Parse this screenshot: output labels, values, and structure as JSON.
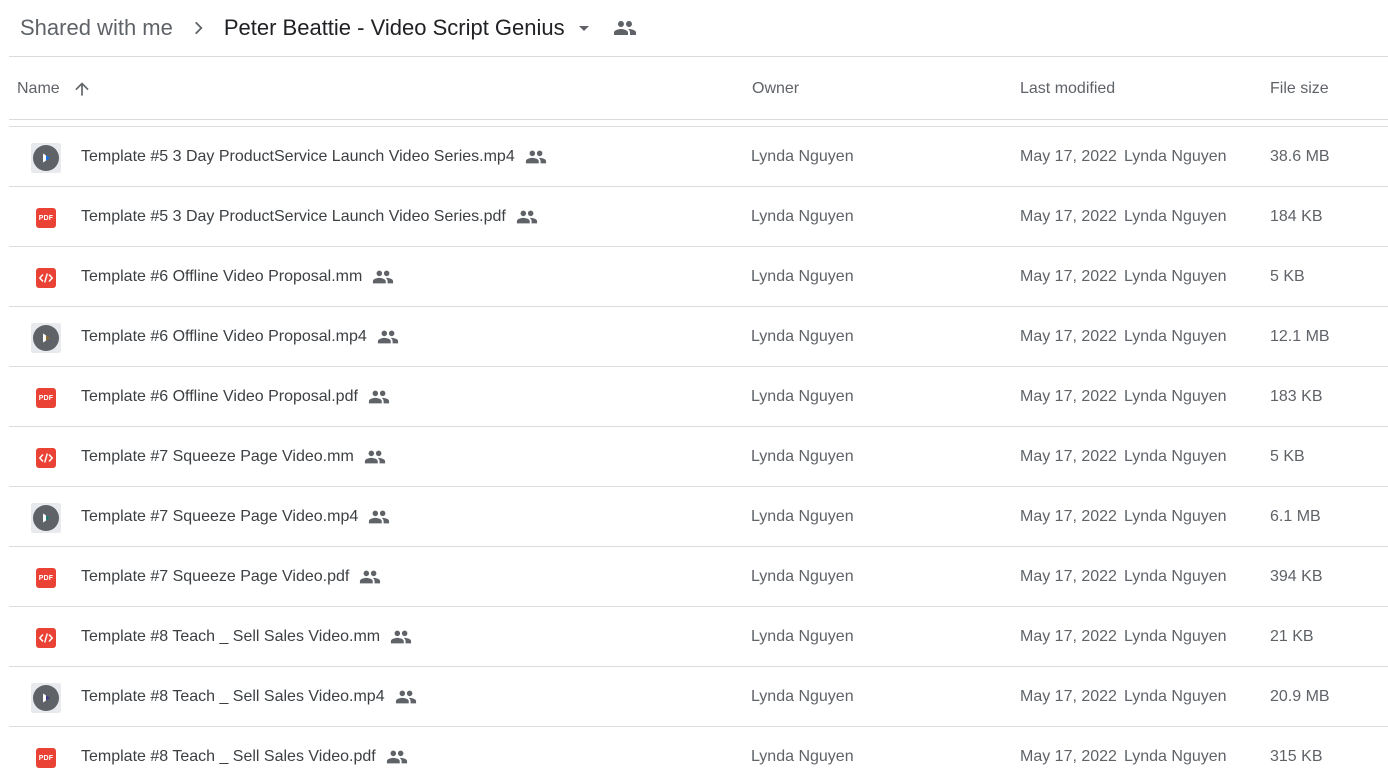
{
  "breadcrumb": {
    "root": "Shared with me",
    "current": "Peter Beattie - Video Script Genius"
  },
  "columns": {
    "name": "Name",
    "owner": "Owner",
    "last_modified": "Last modified",
    "file_size": "File size"
  },
  "colors": {
    "pdf_red": "#ea4335",
    "text": "#3c4043",
    "muted": "#5f6368",
    "divider": "#dadce0"
  },
  "files": [
    {
      "name": "Template #5 3 Day ProductService Launch Video Series.mp4",
      "type": "video",
      "owner": "Lynda Nguyen",
      "modified_date": "May 17, 2022",
      "modified_by": "Lynda Nguyen",
      "size": "38.6 MB",
      "thumb_color": "#1a73e8"
    },
    {
      "name": "Template #5 3 Day ProductService Launch Video Series.pdf",
      "type": "pdf",
      "owner": "Lynda Nguyen",
      "modified_date": "May 17, 2022",
      "modified_by": "Lynda Nguyen",
      "size": "184 KB"
    },
    {
      "name": "Template #6 Offline Video Proposal.mm",
      "type": "code",
      "owner": "Lynda Nguyen",
      "modified_date": "May 17, 2022",
      "modified_by": "Lynda Nguyen",
      "size": "5 KB"
    },
    {
      "name": "Template #6 Offline Video Proposal.mp4",
      "type": "video",
      "owner": "Lynda Nguyen",
      "modified_date": "May 17, 2022",
      "modified_by": "Lynda Nguyen",
      "size": "12.1 MB",
      "thumb_color": "#8d6e2f"
    },
    {
      "name": "Template #6 Offline Video Proposal.pdf",
      "type": "pdf",
      "owner": "Lynda Nguyen",
      "modified_date": "May 17, 2022",
      "modified_by": "Lynda Nguyen",
      "size": "183 KB"
    },
    {
      "name": "Template #7 Squeeze Page Video.mm",
      "type": "code",
      "owner": "Lynda Nguyen",
      "modified_date": "May 17, 2022",
      "modified_by": "Lynda Nguyen",
      "size": "5 KB"
    },
    {
      "name": "Template #7 Squeeze Page Video.mp4",
      "type": "video",
      "owner": "Lynda Nguyen",
      "modified_date": "May 17, 2022",
      "modified_by": "Lynda Nguyen",
      "size": "6.1 MB",
      "thumb_color": "#1e7a73"
    },
    {
      "name": "Template #7 Squeeze Page Video.pdf",
      "type": "pdf",
      "owner": "Lynda Nguyen",
      "modified_date": "May 17, 2022",
      "modified_by": "Lynda Nguyen",
      "size": "394 KB"
    },
    {
      "name": "Template #8 Teach _ Sell Sales Video.mm",
      "type": "code",
      "owner": "Lynda Nguyen",
      "modified_date": "May 17, 2022",
      "modified_by": "Lynda Nguyen",
      "size": "21 KB"
    },
    {
      "name": "Template #8 Teach _ Sell Sales Video.mp4",
      "type": "video",
      "owner": "Lynda Nguyen",
      "modified_date": "May 17, 2022",
      "modified_by": "Lynda Nguyen",
      "size": "20.9 MB",
      "thumb_color": "#3c3a8c"
    },
    {
      "name": "Template #8 Teach _ Sell Sales Video.pdf",
      "type": "pdf",
      "owner": "Lynda Nguyen",
      "modified_date": "May 17, 2022",
      "modified_by": "Lynda Nguyen",
      "size": "315 KB"
    }
  ],
  "icons": {
    "breadcrumb_separator": "chevron-right-icon",
    "folder_menu": "arrow-drop-down-icon",
    "folder_shared": "people-icon",
    "sort": "arrow-up-icon",
    "row_shared": "people-icon",
    "pdf_label": "PDF"
  }
}
